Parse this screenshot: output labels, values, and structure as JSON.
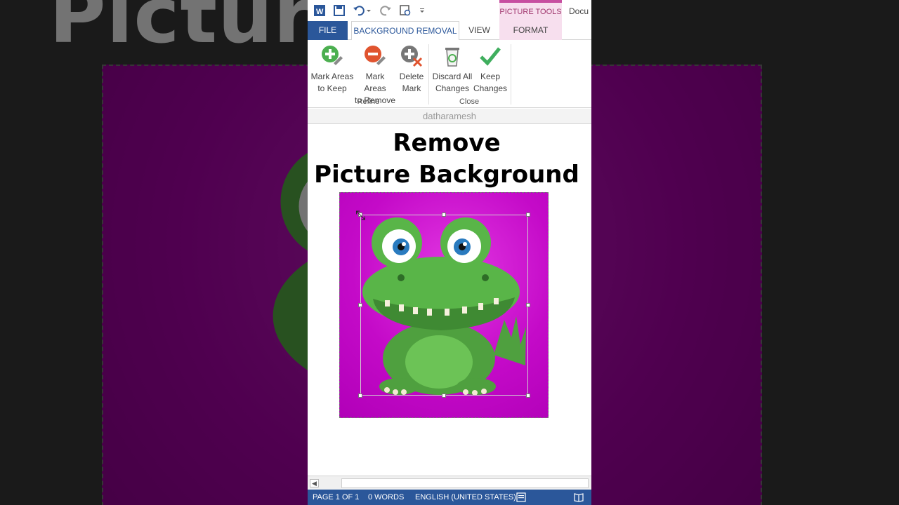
{
  "qat": {
    "icons": [
      "word-icon",
      "save-icon",
      "undo-icon",
      "redo-icon",
      "print-preview-icon",
      "customize-icon"
    ]
  },
  "context_tab": {
    "label": "PICTURE TOOLS",
    "color": "#c74ea0"
  },
  "document_title": "Docu",
  "tabs": {
    "file": "FILE",
    "background_removal": "BACKGROUND REMOVAL",
    "view": "VIEW",
    "format": "FORMAT"
  },
  "ribbon": {
    "mark_keep": [
      "Mark Areas",
      "to Keep"
    ],
    "mark_remove": [
      "Mark Areas",
      "to Remove"
    ],
    "delete_mark": [
      "Delete",
      "Mark"
    ],
    "discard_all": [
      "Discard All",
      "Changes"
    ],
    "keep_changes": [
      "Keep",
      "Changes"
    ],
    "group_refine": "Refine",
    "group_close": "Close"
  },
  "author": "datharamesh",
  "document": {
    "heading_line1": "Remove",
    "heading_line2": "Picture Background"
  },
  "status": {
    "page": "PAGE 1 OF 1",
    "words": "0 WORDS",
    "language": "ENGLISH (UNITED STATES)"
  },
  "background_overlay_text": "Picture",
  "colors": {
    "accent": "#2b579a",
    "picture_bg": "#c40ac8",
    "croc": "#5cb84a"
  }
}
